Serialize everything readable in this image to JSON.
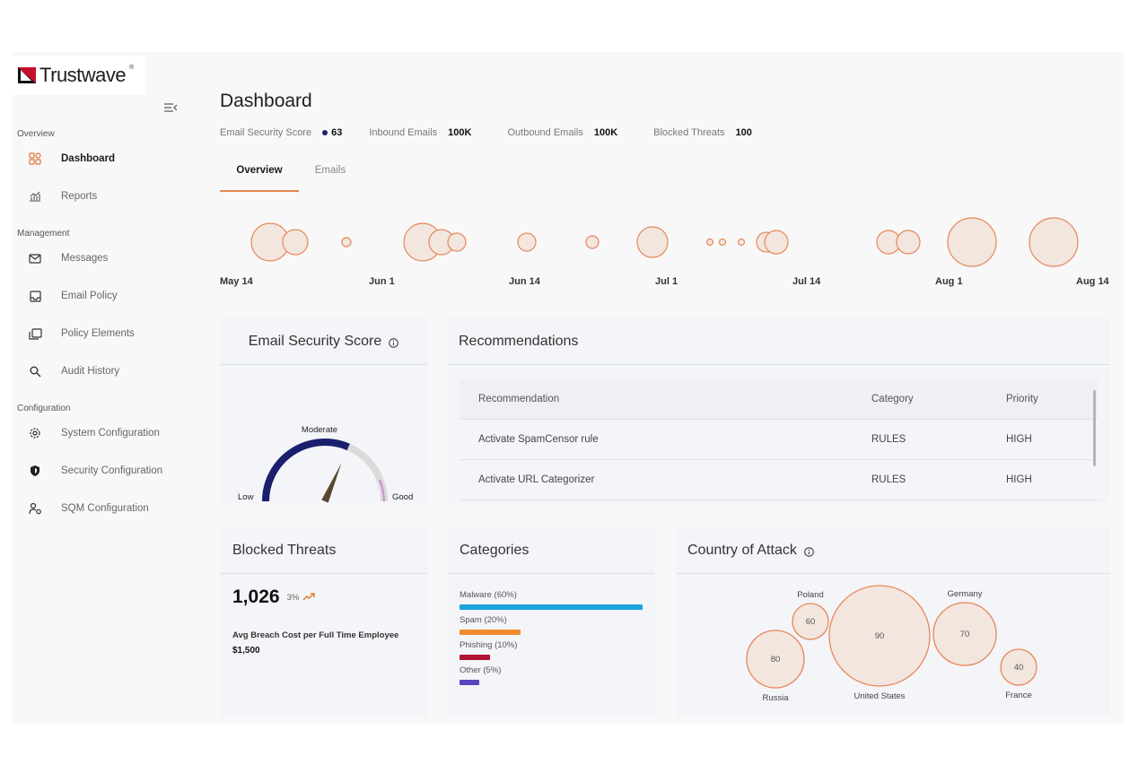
{
  "brand": {
    "name": "Trustwave",
    "reg": "®"
  },
  "sidebar": {
    "sections": [
      {
        "title": "Overview",
        "items": [
          {
            "label": "Dashboard",
            "icon": "dashboard-icon",
            "active": true
          },
          {
            "label": "Reports",
            "icon": "reports-icon"
          }
        ]
      },
      {
        "title": "Management",
        "items": [
          {
            "label": "Messages",
            "icon": "mail-icon"
          },
          {
            "label": "Email Policy",
            "icon": "inbox-icon"
          },
          {
            "label": "Policy Elements",
            "icon": "folders-icon"
          },
          {
            "label": "Audit History",
            "icon": "search-icon"
          }
        ]
      },
      {
        "title": "Configuration",
        "items": [
          {
            "label": "System Configuration",
            "icon": "gear-icon"
          },
          {
            "label": "Security Configuration",
            "icon": "shield-icon"
          },
          {
            "label": "SQM Configuration",
            "icon": "user-gear-icon"
          }
        ]
      }
    ]
  },
  "header": {
    "title": "Dashboard",
    "metrics": [
      {
        "label": "Email Security Score",
        "value": "63",
        "dot_color": "#1a1f6e"
      },
      {
        "label": "Inbound Emails",
        "value": "100K"
      },
      {
        "label": "Outbound Emails",
        "value": "100K"
      },
      {
        "label": "Blocked Threats",
        "value": "100"
      }
    ],
    "tabs": [
      {
        "label": "Overview",
        "active": true
      },
      {
        "label": "Emails",
        "active": false
      }
    ]
  },
  "timeline": {
    "labels": [
      "May 14",
      "Jun 1",
      "Jun 14",
      "Jul 1",
      "Jul 14",
      "Aug 1",
      "Aug 14"
    ],
    "bubble_color": "#e8875a",
    "bubble_fill": "#f2e6df"
  },
  "score_card": {
    "title": "Email Security Score",
    "gauge": {
      "low": "Low",
      "mid": "Moderate",
      "high": "Good",
      "score": 63,
      "max": 100
    }
  },
  "recommendations": {
    "title": "Recommendations",
    "columns": [
      "Recommendation",
      "Category",
      "Priority"
    ],
    "rows": [
      [
        "Activate SpamCensor rule",
        "RULES",
        "HIGH"
      ],
      [
        "Activate URL Categorizer",
        "RULES",
        "HIGH"
      ]
    ]
  },
  "blocked_threats": {
    "title": "Blocked Threats",
    "value": "1,026",
    "change": "3%",
    "sub_label": "Avg Breach Cost per Full Time Employee",
    "sub_value": "$1,500"
  },
  "categories": {
    "title": "Categories",
    "items": [
      {
        "label": "Malware (60%)",
        "value": 60,
        "color": "#1aa3dc"
      },
      {
        "label": "Spam (20%)",
        "value": 20,
        "color": "#f18c2d"
      },
      {
        "label": "Phishing (10%)",
        "value": 10,
        "color": "#b01432"
      },
      {
        "label": "Other (5%)",
        "value": 5,
        "color": "#5a45c0"
      }
    ]
  },
  "country_attack": {
    "title": "Country of Attack",
    "countries": [
      {
        "name": "Russia",
        "value": 80
      },
      {
        "name": "Poland",
        "value": 60
      },
      {
        "name": "United States",
        "value": 90
      },
      {
        "name": "Germany",
        "value": 70
      },
      {
        "name": "France",
        "value": 40
      }
    ]
  },
  "colors": {
    "accent": "#e08a56",
    "gauge_fill": "#1a1f6e",
    "gauge_track": "#d9d6d6"
  }
}
